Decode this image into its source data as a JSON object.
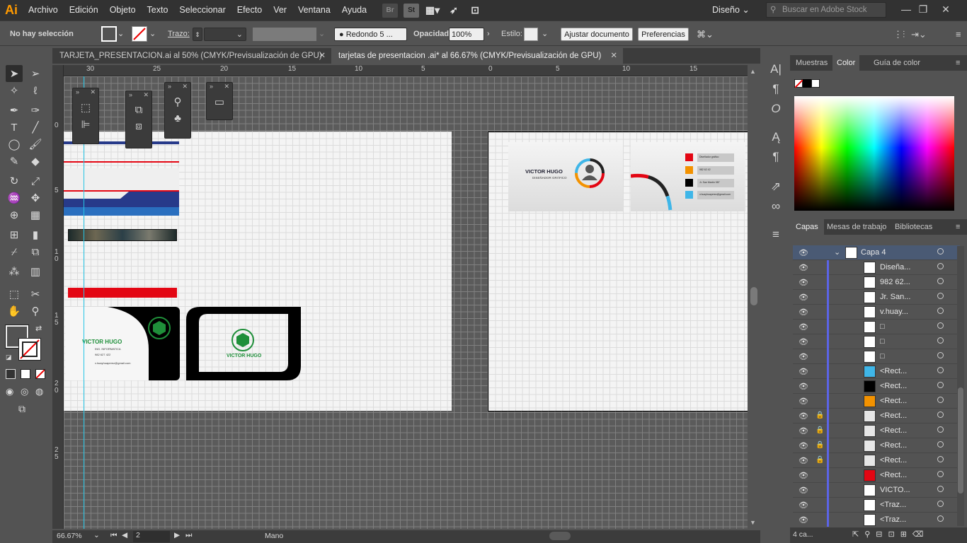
{
  "app": {
    "logo": "Ai",
    "menus": [
      "Archivo",
      "Edición",
      "Objeto",
      "Texto",
      "Seleccionar",
      "Efecto",
      "Ver",
      "Ventana",
      "Ayuda"
    ],
    "bridge": "Br",
    "stock": "St",
    "workspace": "Diseño",
    "search_placeholder": "Buscar en Adobe Stock"
  },
  "control": {
    "selection": "No hay selección",
    "stroke_label": "Trazo:",
    "brush": "Redondo 5 ...",
    "opacity_label": "Opacidad:",
    "opacity_value": "100%",
    "style_label": "Estilo:",
    "adjust_doc": "Ajustar documento",
    "preferences": "Preferencias"
  },
  "tabs": [
    {
      "label": "TARJETA_PRESENTACION.ai al 50% (CMYK/Previsualización de GPU)",
      "close": "✕"
    },
    {
      "label": "tarjetas de presentacion .ai* al 66.67% (CMYK/Previsualización de GPU)",
      "close": "✕"
    }
  ],
  "ruler": {
    "h": [
      "30",
      "25",
      "20",
      "15",
      "10",
      "5",
      "0",
      "5",
      "10",
      "15"
    ],
    "v": [
      "0",
      "5",
      "1 0",
      "1 5",
      "2 0",
      "2 5"
    ]
  },
  "cards": {
    "name": "VICTOR HUGO",
    "role": "DISEÑADOR GRÁFICO",
    "tag": "ING. INFORMATICA",
    "phone": "982 627 422",
    "email": "v.huayhuaperez@gmail.com",
    "c1": "Diseñador gráfico",
    "c2": "982 62 42",
    "c3": "Jr. San Martín 987",
    "c4": "v.huayhuaperez@gmail.com"
  },
  "status": {
    "zoom": "66.67%",
    "page": "2",
    "tool": "Mano"
  },
  "panel": {
    "tabs_top": [
      "Muestras",
      "Color",
      "Guía de color"
    ],
    "tabs_layers": [
      "Capas",
      "Mesas de trabajo",
      "Bibliotecas"
    ],
    "footer": "4 ca..."
  },
  "layers": [
    {
      "name": "Capa 4",
      "lock": false,
      "thumb": "#ffffff"
    },
    {
      "name": "Diseña...",
      "lock": false,
      "thumb": "#ffffff"
    },
    {
      "name": "982 62...",
      "lock": false,
      "thumb": "#ffffff"
    },
    {
      "name": "Jr. San...",
      "lock": false,
      "thumb": "#ffffff"
    },
    {
      "name": "v.huay...",
      "lock": false,
      "thumb": "#ffffff"
    },
    {
      "name": "□",
      "lock": false,
      "thumb": "#ffffff"
    },
    {
      "name": "□",
      "lock": false,
      "thumb": "#ffffff"
    },
    {
      "name": "□",
      "lock": false,
      "thumb": "#ffffff"
    },
    {
      "name": "<Rect...",
      "lock": false,
      "thumb": "#3fb6e8"
    },
    {
      "name": "<Rect...",
      "lock": false,
      "thumb": "#000000"
    },
    {
      "name": "<Rect...",
      "lock": false,
      "thumb": "#f39200"
    },
    {
      "name": "<Rect...",
      "lock": true,
      "thumb": "#e6e6e6"
    },
    {
      "name": "<Rect...",
      "lock": true,
      "thumb": "#e6e6e6"
    },
    {
      "name": "<Rect...",
      "lock": true,
      "thumb": "#e6e6e6"
    },
    {
      "name": "<Rect...",
      "lock": true,
      "thumb": "#e6e6e6"
    },
    {
      "name": "<Rect...",
      "lock": false,
      "thumb": "#e30613"
    },
    {
      "name": "VICTO...",
      "lock": false,
      "thumb": "#ffffff"
    },
    {
      "name": "<Traz...",
      "lock": false,
      "thumb": "#ffffff"
    },
    {
      "name": "<Traz...",
      "lock": false,
      "thumb": "#ffffff"
    }
  ]
}
